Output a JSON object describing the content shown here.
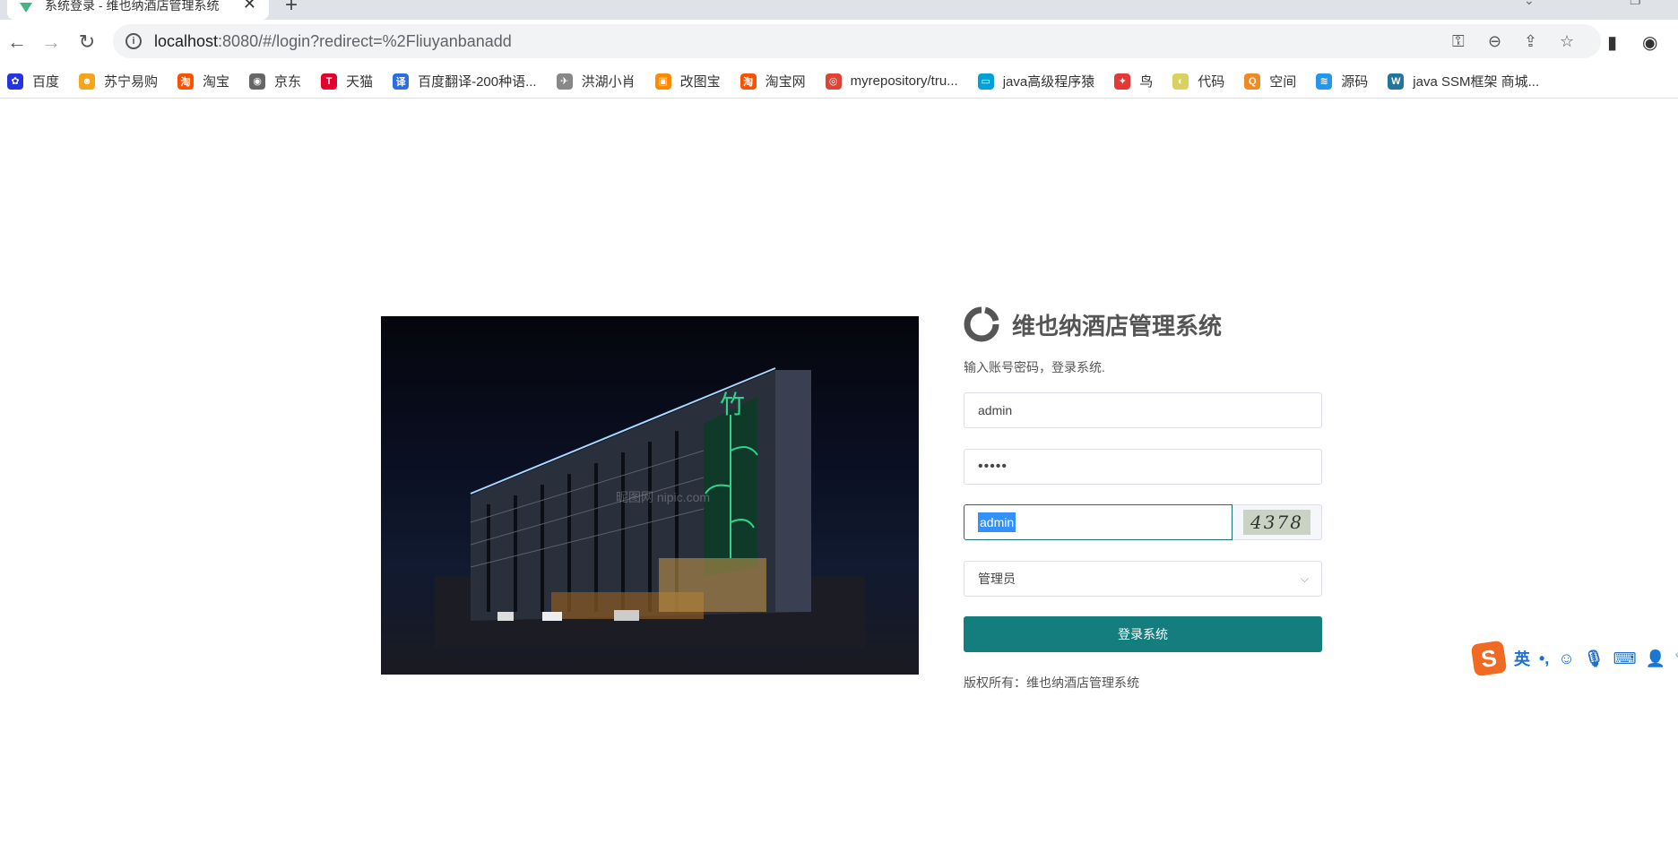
{
  "browser": {
    "tab_title": "系统登录 - 维也纳酒店管理系统",
    "tab_close": "✕",
    "new_tab": "+",
    "url_host": "localhost",
    "url_rest": ":8080/#/login?redirect=%2Fliuyanbanadd",
    "bookmarks": [
      {
        "label": "百度",
        "icon": "baidu-paw-icon",
        "color": "#2932e1",
        "glyph": "✿"
      },
      {
        "label": "苏宁易购",
        "icon": "suning-icon",
        "color": "#f7a31c",
        "glyph": "☻"
      },
      {
        "label": "淘宝",
        "icon": "taobao-icon",
        "color": "#ff5000",
        "glyph": "淘"
      },
      {
        "label": "京东",
        "icon": "globe-icon",
        "color": "#666666",
        "glyph": "◉"
      },
      {
        "label": "天猫",
        "icon": "tmall-icon",
        "color": "#e4002b",
        "glyph": "T"
      },
      {
        "label": "百度翻译-200种语...",
        "icon": "translate-icon",
        "color": "#2b6de5",
        "glyph": "译"
      },
      {
        "label": "洪湖小肖",
        "icon": "bird-icon",
        "color": "#888888",
        "glyph": "✈"
      },
      {
        "label": "改图宝",
        "icon": "gaitubao-icon",
        "color": "#ff8a00",
        "glyph": "▣"
      },
      {
        "label": "淘宝网",
        "icon": "taobao-icon",
        "color": "#ff5000",
        "glyph": "淘"
      },
      {
        "label": "myrepository/tru...",
        "icon": "chrome-icon",
        "color": "#db4437",
        "glyph": "◎"
      },
      {
        "label": "java高级程序猿",
        "icon": "bilibili-icon",
        "color": "#00a1d6",
        "glyph": "▭"
      },
      {
        "label": "鸟",
        "icon": "bird-icon",
        "color": "#e53935",
        "glyph": "✦"
      },
      {
        "label": "代码",
        "icon": "code-icon",
        "color": "#d8d260",
        "glyph": "◐"
      },
      {
        "label": "空间",
        "icon": "space-icon",
        "color": "#f08a24",
        "glyph": "Q"
      },
      {
        "label": "源码",
        "icon": "docker-icon",
        "color": "#2496ed",
        "glyph": "≋"
      },
      {
        "label": "java SSM框架 商城...",
        "icon": "wordpress-icon",
        "color": "#21759b",
        "glyph": "W"
      }
    ]
  },
  "hero": {
    "watermark": "昵图网 nipic.com"
  },
  "login": {
    "system_title": "维也纳酒店管理系统",
    "subtitle": "输入账号密码，登录系统.",
    "username_value": "admin",
    "password_value": "•••••",
    "captcha_input_value": "admin",
    "captcha_code": "4378",
    "role_value": "管理员",
    "submit_label": "登录系统",
    "copyright": "版权所有：维也纳酒店管理系统",
    "accent_color": "#137e7d"
  },
  "ime": {
    "logo": "S",
    "lang": "英",
    "punct": "•,"
  }
}
